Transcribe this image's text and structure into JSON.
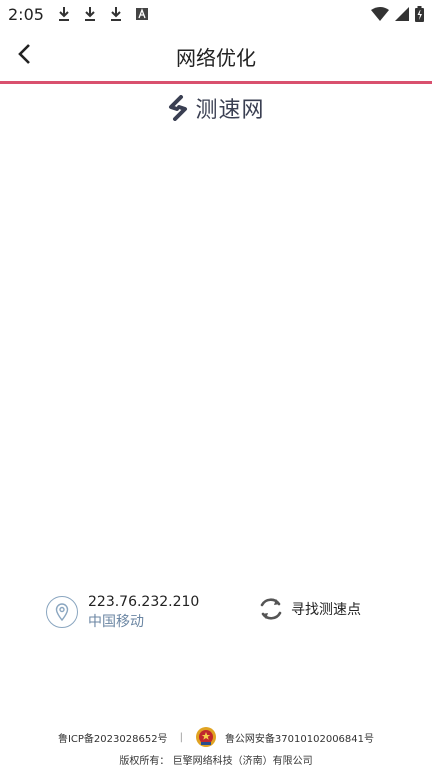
{
  "status_bar": {
    "time": "2:05"
  },
  "header": {
    "title": "网络优化"
  },
  "logo": {
    "text": "测速网"
  },
  "connection": {
    "ip": "223.76.232.210",
    "carrier": "中国移动"
  },
  "actions": {
    "find_server_label": "寻找测速点"
  },
  "footer": {
    "icp": "鲁ICP备2023028652号",
    "separator": "|",
    "police_record": "鲁公网安备37010102006841号",
    "copyright_prefix": "版权所有：",
    "company": "巨擎网络科技（济南）有限公司"
  },
  "colors": {
    "accent_line": "#d9506e",
    "carrier_text": "#6b86a3",
    "icon_stroke": "#8aa6c0"
  }
}
